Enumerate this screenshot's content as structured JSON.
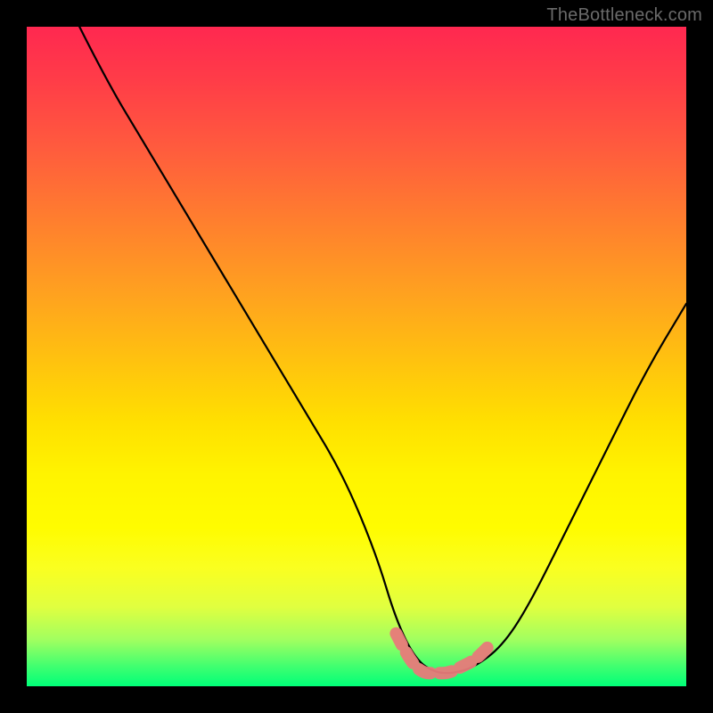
{
  "watermark": "TheBottleneck.com",
  "chart_data": {
    "type": "line",
    "title": "",
    "xlabel": "",
    "ylabel": "",
    "xlim": [
      0,
      100
    ],
    "ylim": [
      0,
      100
    ],
    "background_gradient": {
      "top_color": "#ff2850",
      "mid_color": "#ffe000",
      "bottom_color": "#00ff78"
    },
    "series": [
      {
        "name": "bottleneck-curve",
        "color": "#000000",
        "x": [
          8,
          12,
          18,
          24,
          30,
          36,
          42,
          48,
          53,
          56,
          59,
          62,
          65,
          68,
          72,
          76,
          82,
          88,
          94,
          100
        ],
        "y": [
          100,
          92,
          82,
          72,
          62,
          52,
          42,
          32,
          20,
          10,
          4,
          2,
          2,
          3,
          6,
          12,
          24,
          36,
          48,
          58
        ]
      },
      {
        "name": "optimal-zone-marker",
        "color": "#e87a7a",
        "x": [
          56,
          58,
          60,
          62,
          64,
          66,
          68,
          70
        ],
        "y": [
          8,
          4,
          2,
          2,
          2,
          3,
          4,
          6
        ]
      }
    ]
  }
}
